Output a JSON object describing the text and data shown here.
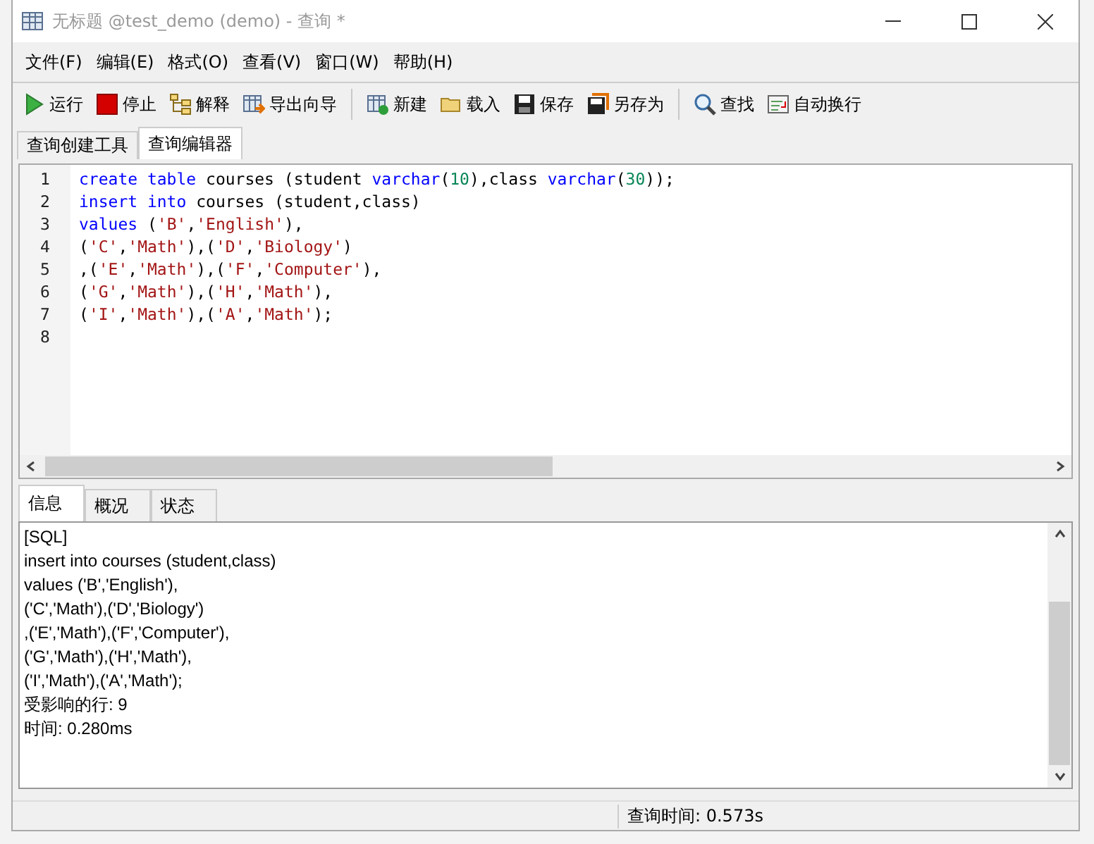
{
  "window": {
    "title": "无标题 @test_demo (demo) - 查询 *"
  },
  "menu": [
    "文件(F)",
    "编辑(E)",
    "格式(O)",
    "查看(V)",
    "窗口(W)",
    "帮助(H)"
  ],
  "toolbar": [
    {
      "kind": "run",
      "label": "运行"
    },
    {
      "kind": "stop",
      "label": "停止"
    },
    {
      "kind": "explain",
      "label": "解释"
    },
    {
      "kind": "export",
      "label": "导出向导"
    },
    {
      "kind": "separator"
    },
    {
      "kind": "new",
      "label": "新建"
    },
    {
      "kind": "load",
      "label": "载入"
    },
    {
      "kind": "save",
      "label": "保存"
    },
    {
      "kind": "saveas",
      "label": "另存为"
    },
    {
      "kind": "separator"
    },
    {
      "kind": "find",
      "label": "查找"
    },
    {
      "kind": "wrap",
      "label": "自动换行"
    }
  ],
  "editor_tabs": [
    {
      "label": "查询创建工具",
      "selected": false
    },
    {
      "label": "查询编辑器",
      "selected": true
    }
  ],
  "code_lines": [
    {
      "number": "1",
      "tokens": [
        {
          "kind": "keyword",
          "text": "create table"
        },
        {
          "kind": "plain",
          "text": " courses (student "
        },
        {
          "kind": "keyword",
          "text": "varchar"
        },
        {
          "kind": "plain",
          "text": "("
        },
        {
          "kind": "number",
          "text": "10"
        },
        {
          "kind": "plain",
          "text": "),class "
        },
        {
          "kind": "keyword",
          "text": "varchar"
        },
        {
          "kind": "plain",
          "text": "("
        },
        {
          "kind": "number",
          "text": "30"
        },
        {
          "kind": "plain",
          "text": "));"
        }
      ]
    },
    {
      "number": "2",
      "tokens": [
        {
          "kind": "keyword",
          "text": "insert into"
        },
        {
          "kind": "plain",
          "text": " courses (student,class)"
        }
      ]
    },
    {
      "number": "3",
      "tokens": [
        {
          "kind": "keyword",
          "text": "values"
        },
        {
          "kind": "plain",
          "text": " ("
        },
        {
          "kind": "string",
          "text": "'B'"
        },
        {
          "kind": "plain",
          "text": ","
        },
        {
          "kind": "string",
          "text": "'English'"
        },
        {
          "kind": "plain",
          "text": "),"
        }
      ]
    },
    {
      "number": "4",
      "tokens": [
        {
          "kind": "plain",
          "text": "("
        },
        {
          "kind": "string",
          "text": "'C'"
        },
        {
          "kind": "plain",
          "text": ","
        },
        {
          "kind": "string",
          "text": "'Math'"
        },
        {
          "kind": "plain",
          "text": "),("
        },
        {
          "kind": "string",
          "text": "'D'"
        },
        {
          "kind": "plain",
          "text": ","
        },
        {
          "kind": "string",
          "text": "'Biology'"
        },
        {
          "kind": "plain",
          "text": ")"
        }
      ]
    },
    {
      "number": "5",
      "tokens": [
        {
          "kind": "plain",
          "text": ",("
        },
        {
          "kind": "string",
          "text": "'E'"
        },
        {
          "kind": "plain",
          "text": ","
        },
        {
          "kind": "string",
          "text": "'Math'"
        },
        {
          "kind": "plain",
          "text": "),("
        },
        {
          "kind": "string",
          "text": "'F'"
        },
        {
          "kind": "plain",
          "text": ","
        },
        {
          "kind": "string",
          "text": "'Computer'"
        },
        {
          "kind": "plain",
          "text": "),"
        }
      ]
    },
    {
      "number": "6",
      "tokens": [
        {
          "kind": "plain",
          "text": "("
        },
        {
          "kind": "string",
          "text": "'G'"
        },
        {
          "kind": "plain",
          "text": ","
        },
        {
          "kind": "string",
          "text": "'Math'"
        },
        {
          "kind": "plain",
          "text": "),("
        },
        {
          "kind": "string",
          "text": "'H'"
        },
        {
          "kind": "plain",
          "text": ","
        },
        {
          "kind": "string",
          "text": "'Math'"
        },
        {
          "kind": "plain",
          "text": "),"
        }
      ]
    },
    {
      "number": "7",
      "tokens": [
        {
          "kind": "plain",
          "text": "("
        },
        {
          "kind": "string",
          "text": "'I'"
        },
        {
          "kind": "plain",
          "text": ","
        },
        {
          "kind": "string",
          "text": "'Math'"
        },
        {
          "kind": "plain",
          "text": "),("
        },
        {
          "kind": "string",
          "text": "'A'"
        },
        {
          "kind": "plain",
          "text": ","
        },
        {
          "kind": "string",
          "text": "'Math'"
        },
        {
          "kind": "plain",
          "text": ");"
        }
      ]
    },
    {
      "number": "8"
    }
  ],
  "result_tabs": [
    {
      "label": "信息",
      "selected": true
    },
    {
      "label": "概况",
      "selected": false
    },
    {
      "label": "状态",
      "selected": false
    }
  ],
  "message_lines": [
    "[SQL]",
    "insert into courses (student,class)",
    "values ('B','English'),",
    "('C','Math'),('D','Biology')",
    ",('E','Math'),('F','Computer'),",
    "('G','Math'),('H','Math'),",
    "('I','Math'),('A','Math');",
    "受影响的行: 9",
    "时间: 0.280ms"
  ],
  "status_bar": {
    "query_time": "查询时间: 0.573s"
  }
}
